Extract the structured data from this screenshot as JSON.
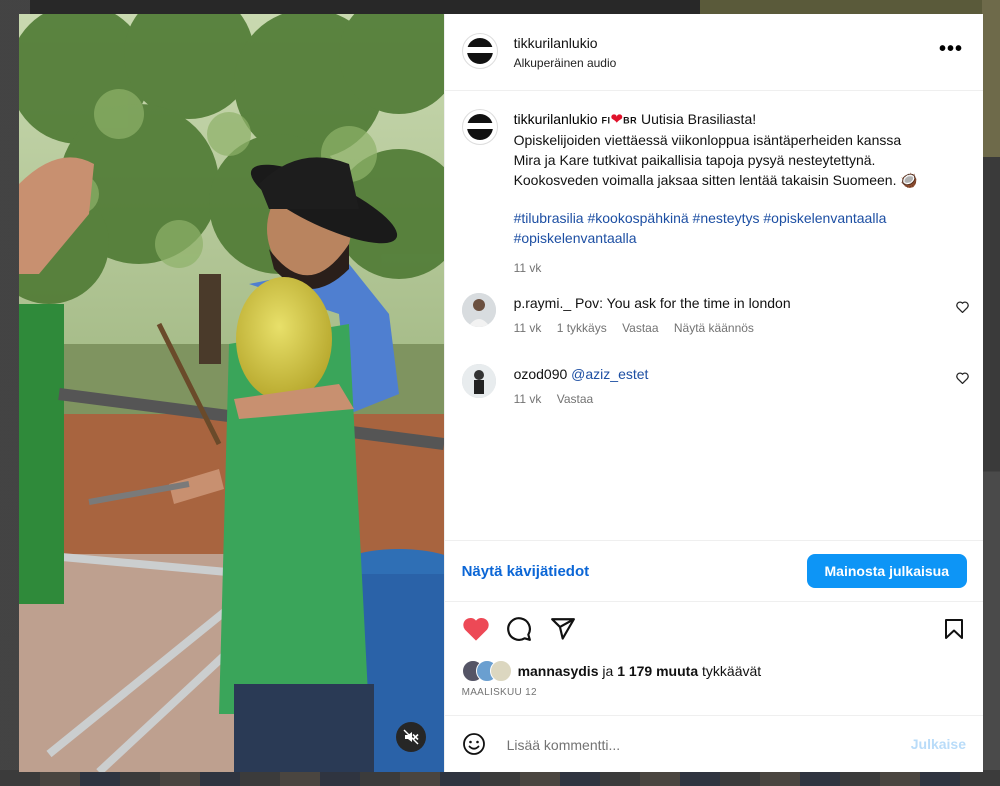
{
  "post": {
    "username": "tikkurilanlukio",
    "audio_label": "Alkuperäinen audio",
    "more_label": "•••"
  },
  "caption": {
    "username": "tikkurilanlukio",
    "flag_fi": "FI",
    "heart": "❤",
    "flag_br": "BR",
    "line1": "Uutisia Brasiliasta!",
    "line2": "Opiskelijoiden viettäessä viikonloppua isäntäperheiden kanssa",
    "line3": "Mira ja Kare tutkivat paikallisia tapoja pysyä nesteytettynä.",
    "line4": "Kookosveden voimalla jaksaa sitten lentää takaisin Suomeen.",
    "coconut": "🥥",
    "hashtags_line1": "#tilubrasilia #kookospähkinä #nesteytys #opiskelenvantaalla",
    "hashtags_line2": "#opiskelenvantaalla",
    "time": "11 vk"
  },
  "comments": [
    {
      "username": "p.raymi._",
      "text": "Pov: You ask for the time in london",
      "time": "11 vk",
      "likes": "1 tykkäys",
      "reply": "Vastaa",
      "translate": "Näytä käännös"
    },
    {
      "username": "ozod090",
      "text": "@aziz_estet",
      "time": "11 vk",
      "reply": "Vastaa"
    }
  ],
  "actions": {
    "insights": "Näytä kävijätiedot",
    "promote": "Mainosta julkaisua"
  },
  "likes": {
    "first_liker": "mannasydis",
    "connector": "ja",
    "others": "1 179 muuta",
    "suffix": "tykkäävät"
  },
  "date": "MAALISKUU 12",
  "add_comment": {
    "placeholder": "Lisää kommentti...",
    "post_label": "Julkaise"
  },
  "icons": {
    "like": "heart-icon",
    "comment": "comment-icon",
    "share": "share-icon",
    "save": "bookmark-icon",
    "mute": "mute-icon",
    "emoji": "emoji-icon"
  },
  "colors": {
    "accent": "#0d95f6",
    "link": "#1d4fa3",
    "liked": "#ed4956"
  }
}
